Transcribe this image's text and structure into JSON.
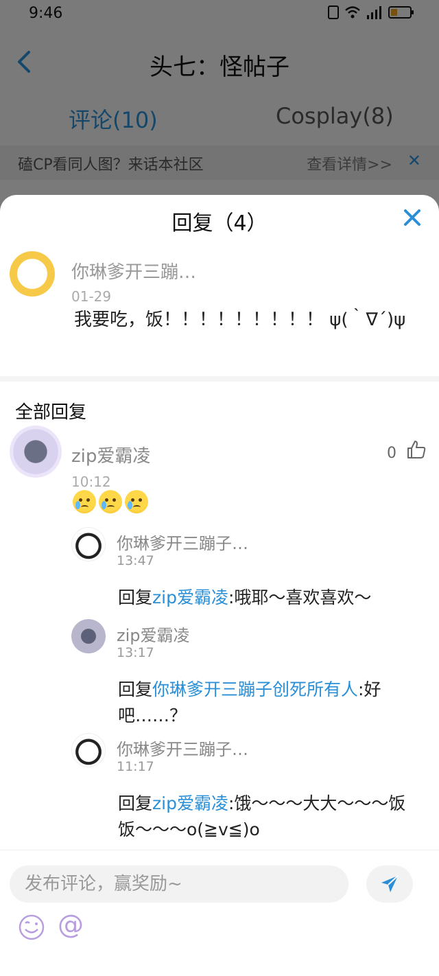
{
  "status_bar": {
    "time": "9:46",
    "network": "4G"
  },
  "nav": {
    "title": "头七：怪帖子"
  },
  "tabs": [
    {
      "label": "评论(10)",
      "active": true
    },
    {
      "label": "Cosplay(8)",
      "active": false
    }
  ],
  "banner": {
    "text": "磕CP看同人图？来话本社区",
    "link": "查看详情>>",
    "close_icon": "close-icon"
  },
  "sheet": {
    "title": "回复（4）",
    "close_icon": "close-icon",
    "main_comment": {
      "author": "你琳爹开三蹦…",
      "time": "01-29",
      "content": "我要吃，饭！！！！！！！！！ ψ(｀∇´)ψ"
    },
    "all_replies_label": "全部回复",
    "reply": {
      "author": "zip爱霸凌",
      "time": "10:12",
      "likes": "0",
      "emoji_count": 3
    },
    "sub_replies": [
      {
        "author": "你琳爹开三蹦子…",
        "time": "13:47",
        "prefix": "回复",
        "mention": "zip爱霸凌",
        "text": ":哦耶～喜欢喜欢～"
      },
      {
        "author": "zip爱霸凌",
        "time": "13:17",
        "prefix": "回复",
        "mention": "你琳爹开三蹦子创死所有人",
        "text": ":好吧……？"
      },
      {
        "author": "你琳爹开三蹦子…",
        "time": "11:17",
        "prefix": "回复",
        "mention": "zip爱霸凌",
        "text": ":饿～～～大大～～～饭饭～～～o(≧v≦)o"
      }
    ]
  },
  "input_bar": {
    "placeholder": "发布评论，赢奖励~",
    "at_symbol": "@"
  },
  "colors": {
    "accent": "#2a8fd6",
    "overlay": "rgba(0,0,0,0.5)"
  }
}
